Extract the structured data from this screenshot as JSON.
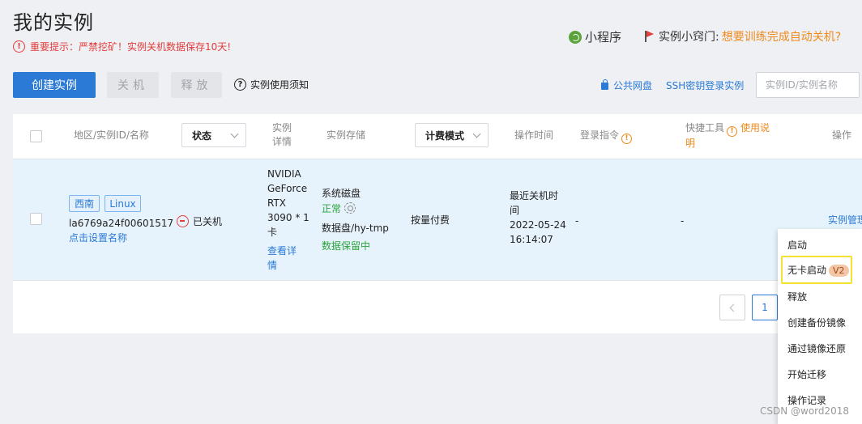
{
  "header": {
    "title": "我的实例",
    "warning": "重要提示：严禁挖矿！实例关机数据保存10天!",
    "miniprogram": "小程序",
    "tips_label": "实例小窍门:",
    "tips_link": "想要训练完成自动关机?"
  },
  "toolbar": {
    "create": "创建实例",
    "stop": "关机",
    "release": "释放",
    "notice": "实例使用须知",
    "public_disk": "公共网盘",
    "ssh_login": "SSH密钥登录实例",
    "search_placeholder": "实例ID/实例名称"
  },
  "table": {
    "headers": {
      "region": "地区/实例ID/名称",
      "status": "状态",
      "detail_1": "实例",
      "detail_2": "详情",
      "storage": "实例存储",
      "billing": "计费模式",
      "op_time": "操作时间",
      "login": "登录指令",
      "tools": "快捷工具",
      "tools_help_1": "使用说",
      "tools_help_2": "明",
      "actions": "操作"
    },
    "row": {
      "tag_region": "西南",
      "tag_os": "Linux",
      "instance_id": "la6769a24f00601517",
      "set_name": "点击设置名称",
      "status": "已关机",
      "gpu_lines": [
        "NVIDIA",
        "GeForce",
        "RTX",
        "3090 * 1",
        "卡"
      ],
      "view_detail_1": "查看详",
      "view_detail_2": "情",
      "sys_disk": "系统磁盘",
      "sys_disk_status": "正常",
      "data_disk": "数据盘/hy-tmp",
      "data_disk_status": "数据保留中",
      "billing": "按量付费",
      "op_time_label_1": "最近关机时",
      "op_time_label_2": "间",
      "op_date": "2022-05-24",
      "op_clock": "16:14:07",
      "login": "-",
      "tools": "-",
      "manage": "实例管理"
    }
  },
  "pagination": {
    "current": "1"
  },
  "menu": {
    "items": [
      "启动",
      "无卡启动",
      "释放",
      "创建备份镜像",
      "通过镜像还原",
      "开始迁移",
      "操作记录"
    ],
    "badge": "V2"
  },
  "watermark": "CSDN @word2018"
}
